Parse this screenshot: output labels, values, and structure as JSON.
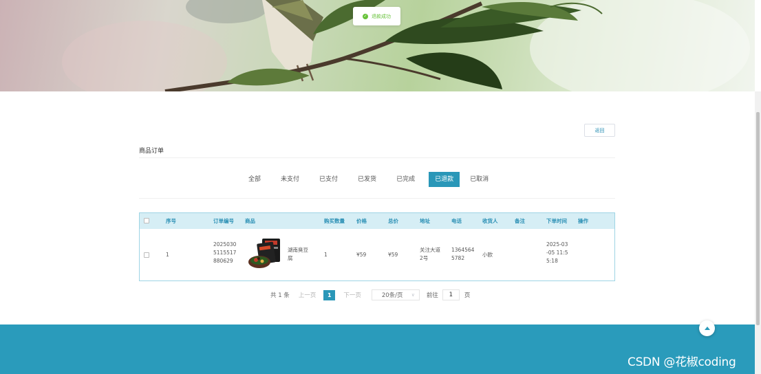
{
  "toast": {
    "text": "退款成功"
  },
  "header": {
    "back_label": "返回",
    "title": "商品订单"
  },
  "tabs": [
    {
      "label": "全部"
    },
    {
      "label": "未支付"
    },
    {
      "label": "已支付"
    },
    {
      "label": "已发货"
    },
    {
      "label": "已完成"
    },
    {
      "label": "已退款",
      "active": true
    },
    {
      "label": "已取消"
    }
  ],
  "table": {
    "headers": {
      "index": "序号",
      "order_no": "订单编号",
      "product": "商品",
      "quantity": "购买数量",
      "price": "价格",
      "total": "总价",
      "address": "地址",
      "phone": "电话",
      "receiver": "收货人",
      "remark": "备注",
      "time": "下单时间",
      "action": "操作"
    },
    "rows": [
      {
        "index": "1",
        "order_no_lines": [
          "2025030",
          "5115517",
          "880629"
        ],
        "product_name_lines": [
          "湖南臭豆",
          "腐"
        ],
        "quantity": "1",
        "price": "¥59",
        "total": "¥59",
        "address_lines": [
          "关注大道",
          "2号"
        ],
        "phone_lines": [
          "1364564",
          "5782"
        ],
        "receiver": "小欧",
        "remark": "",
        "time_lines": [
          "2025-03",
          "-05 11:5",
          "5:18"
        ]
      }
    ]
  },
  "pagination": {
    "total_text": "共 1 条",
    "prev": "上一页",
    "current": "1",
    "next": "下一页",
    "page_size": "20条/页",
    "goto_label": "前往",
    "goto_value": "1",
    "page_suffix": "页"
  },
  "watermark": "CSDN @花椒coding",
  "colors": {
    "accent": "#2a97b8",
    "footer": "#2a9bbb",
    "success": "#67c23a"
  }
}
